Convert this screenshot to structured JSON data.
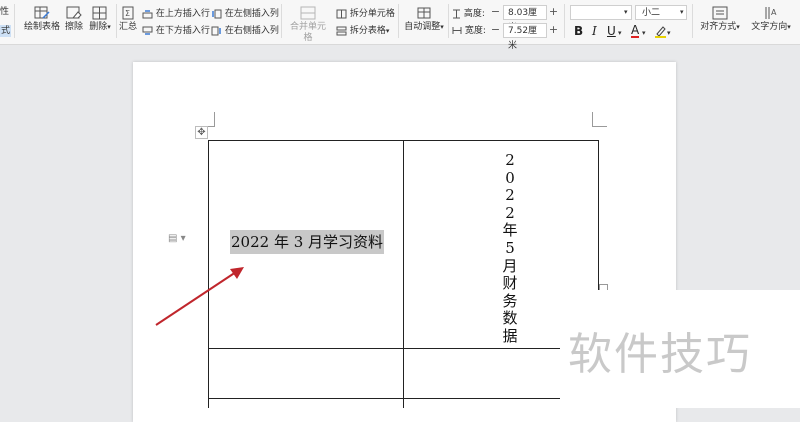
{
  "ribbon": {
    "properties_fragment": "性",
    "style_fragment": "式",
    "draw_table": "绘制表格",
    "erase": "擦除",
    "delete": "删除",
    "summary": "汇总",
    "insert_above": "在上方插入行",
    "insert_below": "在下方插入行",
    "insert_left": "在左侧插入列",
    "insert_right": "在右侧插入列",
    "merge_cells": "合并单元格",
    "split_cells": "拆分单元格",
    "split_table": "拆分表格",
    "auto_fit": "自动调整",
    "height_label": "高度:",
    "height_value": "8.03厘米",
    "width_label": "宽度:",
    "width_value": "7.52厘米",
    "font_size": "小二",
    "align": "对齐方式",
    "text_direction": "文字方向"
  },
  "document": {
    "cell_text": "2022 年 3 月学习资料",
    "vertical_text": [
      "2",
      "0",
      "2",
      "2",
      "年",
      "5",
      "月",
      "财",
      "务",
      "数",
      "据"
    ]
  },
  "watermark": {
    "text": "软件技巧"
  }
}
